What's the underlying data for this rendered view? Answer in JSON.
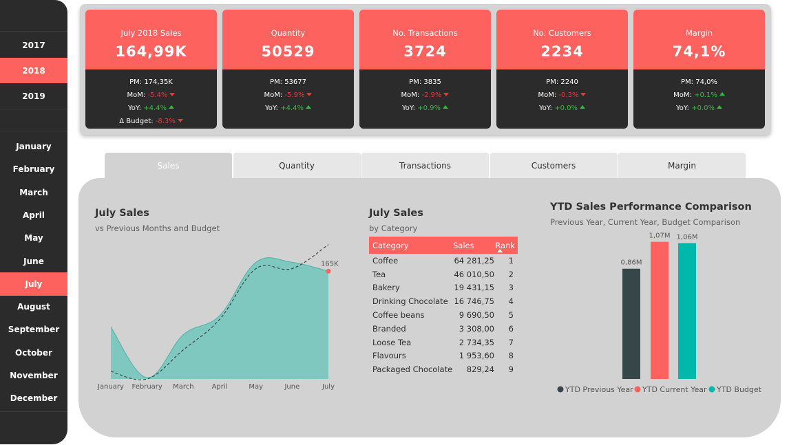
{
  "sidebar": {
    "years": [
      "2017",
      "2018",
      "2019"
    ],
    "selected_year": "2018",
    "months": [
      "January",
      "February",
      "March",
      "April",
      "May",
      "June",
      "July",
      "August",
      "September",
      "October",
      "November",
      "December"
    ],
    "selected_month": "July"
  },
  "kpis": [
    {
      "title": "July 2018 Sales",
      "value": "164,99K",
      "pm": "PM: 174,35K",
      "lines": [
        {
          "label": "MoM:",
          "value": "-5.4%",
          "trend": "down"
        },
        {
          "label": "YoY:",
          "value": "+4.4%",
          "trend": "up"
        },
        {
          "label": "Δ Budget:",
          "value": "-8.3%",
          "trend": "down"
        }
      ]
    },
    {
      "title": "Quantity",
      "value": "50529",
      "pm": "PM: 53677",
      "lines": [
        {
          "label": "MoM:",
          "value": "-5.9%",
          "trend": "down"
        },
        {
          "label": "YoY:",
          "value": "+4.4%",
          "trend": "up"
        }
      ]
    },
    {
      "title": "No. Transactions",
      "value": "3724",
      "pm": "PM: 3835",
      "lines": [
        {
          "label": "MoM:",
          "value": "-2.9%",
          "trend": "down"
        },
        {
          "label": "YoY:",
          "value": "+0.9%",
          "trend": "up"
        }
      ]
    },
    {
      "title": "No. Customers",
      "value": "2234",
      "pm": "PM: 2240",
      "lines": [
        {
          "label": "MoM:",
          "value": "-0.3%",
          "trend": "down"
        },
        {
          "label": "YoY:",
          "value": "+0.0%",
          "trend": "up"
        }
      ]
    },
    {
      "title": "Margin",
      "value": "74,1%",
      "pm": "PM: 74,0%",
      "lines": [
        {
          "label": "MoM:",
          "value": "+0.1%",
          "trend": "up"
        },
        {
          "label": "YoY:",
          "value": "+0.0%",
          "trend": "up"
        }
      ]
    }
  ],
  "tabs": [
    "Sales",
    "Quantity",
    "Transactions",
    "Customers",
    "Margin"
  ],
  "active_tab": "Sales",
  "sales_chart": {
    "title": "July Sales",
    "subtitle": "vs Previous Months and Budget",
    "end_label": "165K"
  },
  "category_table": {
    "title": "July Sales",
    "subtitle": "by Category",
    "headers": [
      "Category",
      "Sales",
      "Rank"
    ],
    "rows": [
      [
        "Coffee",
        "64 281,25",
        "1"
      ],
      [
        "Tea",
        "46 010,50",
        "2"
      ],
      [
        "Bakery",
        "19 431,15",
        "3"
      ],
      [
        "Drinking Chocolate",
        "16 746,75",
        "4"
      ],
      [
        "Coffee beans",
        "9 690,50",
        "5"
      ],
      [
        "Branded",
        "3 308,00",
        "6"
      ],
      [
        "Loose Tea",
        "2 734,35",
        "7"
      ],
      [
        "Flavours",
        "1 953,60",
        "8"
      ],
      [
        "Packaged Chocolate",
        "829,24",
        "9"
      ]
    ]
  },
  "ytd_chart": {
    "title": "YTD Sales Performance Comparison",
    "subtitle": "Previous Year, Current Year, Budget Comparison"
  },
  "colors": {
    "accent": "#fd625e",
    "dark": "#2b2b2b",
    "teal": "#01b8aa",
    "teal_fill": "#7ec8bf",
    "bar_dark": "#374649",
    "negative": "#e23a3a",
    "positive": "#2fbf3c"
  },
  "chart_data": [
    {
      "type": "area",
      "categories": [
        "January",
        "February",
        "March",
        "April",
        "May",
        "June",
        "July"
      ],
      "series": [
        {
          "values": [
            121,
            81,
            115,
            130,
            172,
            172,
            165
          ]
        },
        {
          "values": [
            86,
            80,
            103,
            127,
            167,
            167,
            186
          ]
        }
      ],
      "data_labels": [
        "165K"
      ],
      "ylim": [
        80,
        195
      ]
    },
    {
      "type": "bar",
      "categories": [
        "YTD Previous Year",
        "YTD Current Year",
        "YTD Budget"
      ],
      "values": [
        0.86,
        1.07,
        1.06
      ],
      "data_labels": [
        "0,86M",
        "1,07M",
        "1,06M"
      ],
      "legend": [
        "YTD Previous Year",
        "YTD Current Year",
        "YTD Budget"
      ],
      "legend_position": "bottom",
      "colors": [
        "#374649",
        "#fd625e",
        "#01b8aa"
      ],
      "ylim": [
        0,
        1.1
      ]
    }
  ]
}
